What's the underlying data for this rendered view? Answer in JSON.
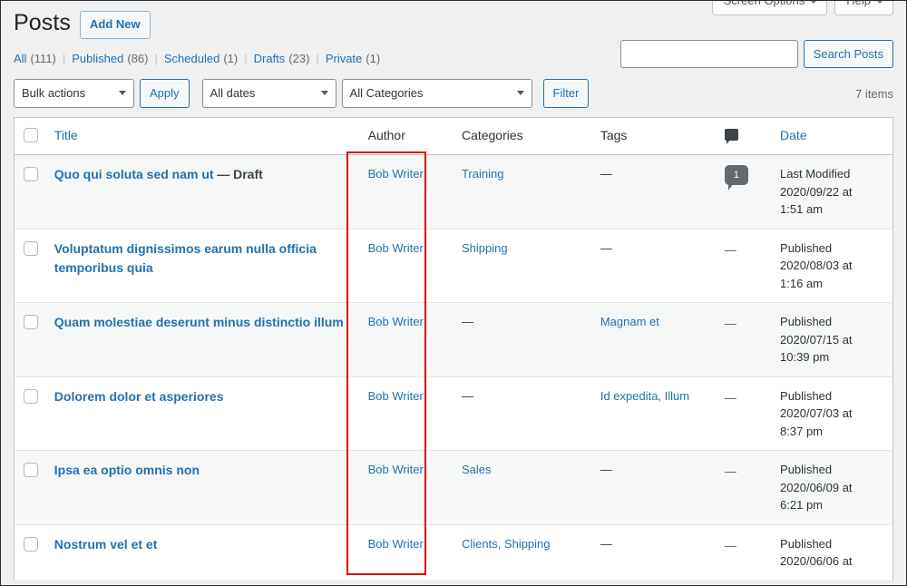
{
  "screen_meta": {
    "screen_options_label": "Screen Options",
    "help_label": "Help"
  },
  "header": {
    "title": "Posts",
    "add_new_label": "Add New"
  },
  "status_links": [
    {
      "label": "All",
      "count": "(111)"
    },
    {
      "label": "Published",
      "count": "(86)"
    },
    {
      "label": "Scheduled",
      "count": "(1)"
    },
    {
      "label": "Drafts",
      "count": "(23)"
    },
    {
      "label": "Private",
      "count": "(1)"
    }
  ],
  "separator": "|",
  "search": {
    "value": "",
    "placeholder": "",
    "button_label": "Search Posts"
  },
  "tablenav": {
    "bulk_actions_value": "Bulk actions",
    "apply_label": "Apply",
    "all_dates_value": "All dates",
    "all_categories_value": "All Categories",
    "filter_label": "Filter",
    "displaying_num": "7 items"
  },
  "table": {
    "columns": {
      "title": "Title",
      "author": "Author",
      "categories": "Categories",
      "tags": "Tags",
      "comments": "comment-icon",
      "date": "Date"
    },
    "rows": [
      {
        "title": "Quo qui soluta sed nam ut",
        "state": "— Draft",
        "author": "Bob Writer",
        "categories": "Training",
        "tags": "—",
        "comments": "1",
        "date_status": "Last Modified",
        "date_value": "2020/09/22 at",
        "date_time": "1:51 am"
      },
      {
        "title": "Voluptatum dignissimos earum nulla officia temporibus quia",
        "state": "",
        "author": "Bob Writer",
        "categories": "Shipping",
        "tags": "—",
        "comments": "—",
        "date_status": "Published",
        "date_value": "2020/08/03 at",
        "date_time": "1:16 am"
      },
      {
        "title": "Quam molestiae deserunt minus distinctio illum",
        "state": "",
        "author": "Bob Writer",
        "categories": "—",
        "tags": "Magnam et",
        "comments": "—",
        "date_status": "Published",
        "date_value": "2020/07/15 at",
        "date_time": "10:39 pm"
      },
      {
        "title": "Dolorem dolor et asperiores",
        "state": "",
        "author": "Bob Writer",
        "categories": "—",
        "tags": "Id expedita, Illum",
        "comments": "—",
        "date_status": "Published",
        "date_value": "2020/07/03 at",
        "date_time": "8:37 pm"
      },
      {
        "title": "Ipsa ea optio omnis non",
        "state": "",
        "author": "Bob Writer",
        "categories": "Sales",
        "tags": "—",
        "comments": "—",
        "date_status": "Published",
        "date_value": "2020/06/09 at",
        "date_time": "6:21 pm"
      },
      {
        "title": "Nostrum vel et et",
        "state": "",
        "author": "Bob Writer",
        "categories": "Clients, Shipping",
        "tags": "—",
        "comments": "—",
        "date_status": "Published",
        "date_value": "2020/06/06 at",
        "date_time": ""
      }
    ]
  },
  "annotation": {
    "color": "#e10000",
    "target": "author-column"
  }
}
